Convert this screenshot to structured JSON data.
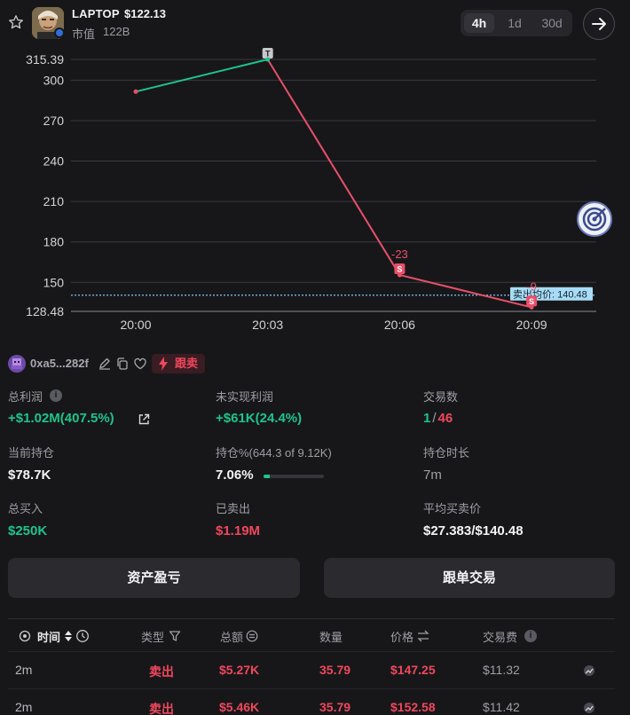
{
  "header": {
    "ticker": "LAPTOP",
    "price": "$122.13",
    "market_cap_label": "市值",
    "market_cap_value": "122B",
    "ranges": [
      "4h",
      "1d",
      "30d"
    ],
    "active_range": "4h"
  },
  "chart_data": {
    "type": "line",
    "y_ticks": [
      "315.39",
      "300",
      "270",
      "240",
      "210",
      "180",
      "150",
      "128.48"
    ],
    "x_ticks": [
      "20:00",
      "20:03",
      "20:06",
      "20:09"
    ],
    "ylim": [
      128.48,
      315.39
    ],
    "series": [
      {
        "x": [
          "20:00",
          "20:03",
          "20:06",
          "20:09"
        ],
        "y": [
          291.5,
          315.39,
          155.5,
          131.5
        ]
      }
    ],
    "markers": [
      {
        "x": "20:03",
        "y": 315.39,
        "label": "T"
      },
      {
        "x": "20:06",
        "y": 155.5,
        "label": "S",
        "annotation": "-23"
      },
      {
        "x": "20:09",
        "y": 131.5,
        "label": "S",
        "annotation": "-9"
      }
    ],
    "avg_sell_line": {
      "value": 140.48,
      "label": "卖出均价: 140.48"
    },
    "colors": {
      "up": "#1ec48a",
      "down": "#e8506a",
      "avg_line": "#7ec8f0",
      "grid": "#3a3a40"
    }
  },
  "wallet": {
    "address": "0xa5...282f",
    "follow_sell_label": "跟卖"
  },
  "stats": {
    "total_profit_label": "总利润",
    "total_profit_value": "+$1.02M(407.5%)",
    "unrealized_label": "未实现利润",
    "unrealized_value": "+$61K(24.4%)",
    "trades_label": "交易数",
    "trades_buy": "1",
    "trades_sep": "/",
    "trades_sell": "46",
    "holding_label": "当前持仓",
    "holding_value": "$78.7K",
    "position_pct_label": "持仓%(644.3 of 9.12K)",
    "position_pct_value": "7.06%",
    "position_pct_fraction": 0.0706,
    "hold_time_label": "持仓时长",
    "hold_time_value": "7m",
    "total_buy_label": "总买入",
    "total_buy_value": "$250K",
    "sold_label": "已卖出",
    "sold_value": "$1.19M",
    "avg_price_label": "平均买卖价",
    "avg_price_value": "$27.383/$140.48"
  },
  "buttons": {
    "asset_pnl": "资产盈亏",
    "copy_trade": "跟单交易"
  },
  "table": {
    "headers": {
      "time": "时间",
      "type": "类型",
      "total": "总额",
      "quantity": "数量",
      "price": "价格",
      "fee": "交易费"
    },
    "rows": [
      {
        "time": "2m",
        "type": "卖出",
        "total": "$5.27K",
        "quantity": "35.79",
        "price": "$147.25",
        "fee": "$11.32"
      },
      {
        "time": "2m",
        "type": "卖出",
        "total": "$5.46K",
        "quantity": "35.79",
        "price": "$152.58",
        "fee": "$11.42"
      }
    ]
  }
}
